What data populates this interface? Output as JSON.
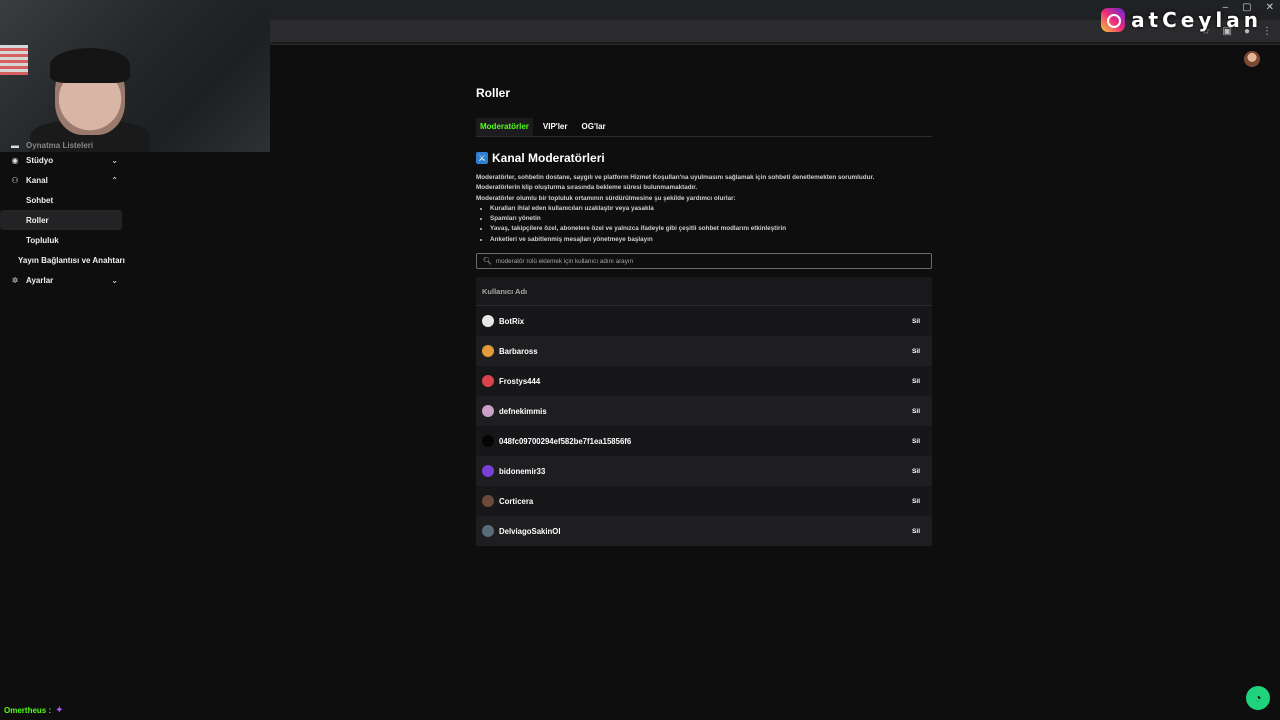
{
  "window_controls": [
    "–",
    "▢",
    "✕"
  ],
  "overlay": {
    "handle": "atCeylan"
  },
  "sidebar": {
    "partial_label": "Oynatma Listeleri",
    "items": [
      {
        "label": "Stüdyo",
        "icon": "studio-icon",
        "chevron": "⌄"
      },
      {
        "label": "Kanal",
        "icon": "channel-icon",
        "chevron": "⌃"
      },
      {
        "label": "Sohbet"
      },
      {
        "label": "Roller"
      },
      {
        "label": "Topluluk"
      },
      {
        "label": "Yayın Bağlantısı ve Anahtarı"
      },
      {
        "label": "Ayarlar",
        "icon": "gear-icon",
        "chevron": "⌄"
      }
    ]
  },
  "main": {
    "title": "Roller",
    "tabs": [
      "Moderatörler",
      "VIP'ler",
      "OG'lar"
    ],
    "active_tab": "Moderatörler",
    "section_title": "Kanal Moderatörleri",
    "description": [
      "Moderatörler, sohbetin dostane, saygılı ve platform Hizmet Koşulları'na uyulmasını sağlamak için sohbeti denetlemekten sorumludur.",
      "Moderatörlerin klip oluşturma sırasında bekleme süresi bulunmamaktadır.",
      "Moderatörler olumlu bir topluluk ortamının sürdürülmesine şu şekilde yardımcı olurlar:"
    ],
    "bullets": [
      "Kuralları ihlal eden kullanıcıları uzaklaştır veya yasakla",
      "Spamları yönetin",
      "Yavaş, takipçilere özel, abonelere özel ve yalnızca ifadeyle gibi çeşitli sohbet modlarını etkinleştirin",
      "Anketleri ve sabitlenmiş mesajları yönetmeye başlayın"
    ],
    "search_placeholder": "moderatör rolü eklemek için kullanıcı adını arayın",
    "table_header": "Kullanıcı Adı",
    "delete_label": "Sil",
    "moderators": [
      {
        "name": "BotRix",
        "avatar_color": "#e8e8e8"
      },
      {
        "name": "Barbaross",
        "avatar_color": "#e39a3b"
      },
      {
        "name": "Frostys444",
        "avatar_color": "#d9434b"
      },
      {
        "name": "defnekimmis",
        "avatar_color": "#c9a1c6"
      },
      {
        "name": "048fc09700294ef582be7f1ea15856f6",
        "avatar_color": "#050505"
      },
      {
        "name": "bidonemir33",
        "avatar_color": "#7a3fd6"
      },
      {
        "name": "Corticera",
        "avatar_color": "#6b4a3a"
      },
      {
        "name": "DelviagoSakinOl",
        "avatar_color": "#5a6c7a"
      }
    ]
  },
  "chat": {
    "user": "Omertheus :",
    "emote": "✦"
  },
  "colors": {
    "accent": "#53fc18",
    "background": "#0e0e0f"
  }
}
